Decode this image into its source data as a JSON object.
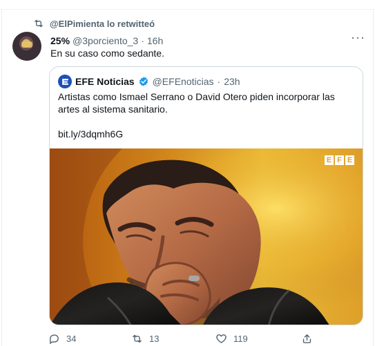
{
  "retweet": {
    "text": "@ElPimienta lo retwitteó"
  },
  "tweet": {
    "name": "25%",
    "handle": "@3porciento_3",
    "separator": "·",
    "time": "16h",
    "text": "En su caso como sedante.",
    "more": "···"
  },
  "quote": {
    "name": "EFE Noticias",
    "handle": "@EFEnoticias",
    "separator": "·",
    "time": "23h",
    "text": "Artistas como Ismael Serrano o David Otero piden incorporar las artes al sistema sanitario.",
    "link": "bit.ly/3dqmh6G",
    "watermark": [
      "E",
      "F",
      "E"
    ]
  },
  "actions": {
    "replies": "34",
    "retweets": "13",
    "likes": "119"
  },
  "colors": {
    "accent": "#1d9bf0",
    "text": "#0f1419",
    "secondary": "#536471",
    "border": "#cfd9de"
  },
  "icons": [
    "retweet-icon",
    "more-icon",
    "verified-icon",
    "reply-icon",
    "like-icon",
    "share-icon"
  ]
}
